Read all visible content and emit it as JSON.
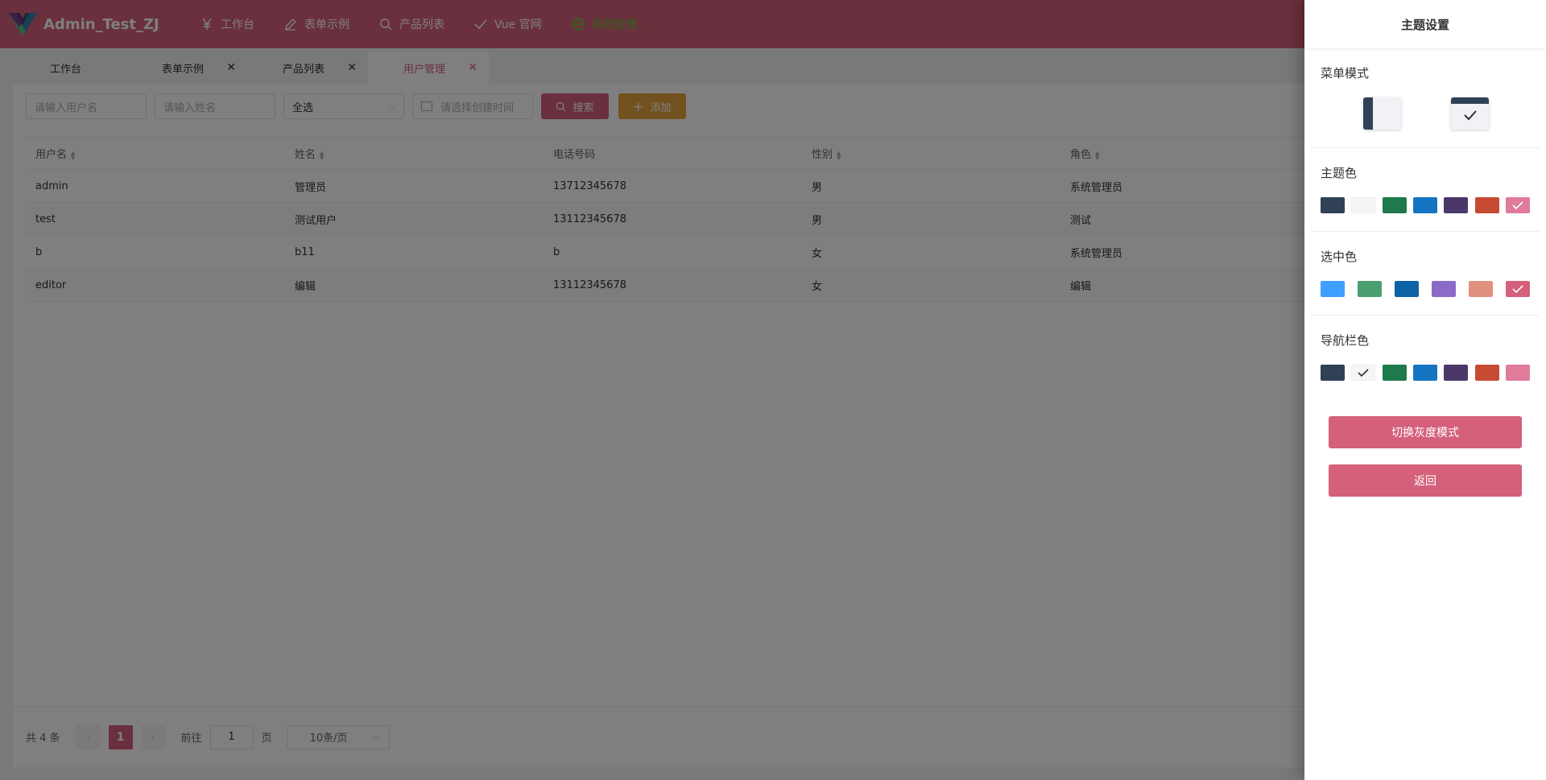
{
  "app": {
    "title": "Admin_Test_ZJ"
  },
  "topnav": [
    {
      "label": "工作台",
      "icon": "yen-icon"
    },
    {
      "label": "表单示例",
      "icon": "edit-icon"
    },
    {
      "label": "产品列表",
      "icon": "search-icon"
    },
    {
      "label": "Vue 官网",
      "icon": "check-icon"
    },
    {
      "label": "系统管理",
      "icon": "globe-icon",
      "active": true
    }
  ],
  "tabs": [
    {
      "label": "工作台",
      "closable": false
    },
    {
      "label": "表单示例",
      "closable": true
    },
    {
      "label": "产品列表",
      "closable": true
    },
    {
      "label": "用户管理",
      "closable": true,
      "active": true
    }
  ],
  "search": {
    "username_placeholder": "请输入用户名",
    "name_placeholder": "请输入姓名",
    "select_value": "全选",
    "date_placeholder": "请选择创建时间",
    "search_label": "搜索",
    "add_label": "添加"
  },
  "table": {
    "columns": [
      "用户名",
      "姓名",
      "电话号码",
      "性别",
      "角色"
    ],
    "rows": [
      [
        "admin",
        "管理员",
        "13712345678",
        "男",
        "系统管理员"
      ],
      [
        "test",
        "测试用户",
        "13112345678",
        "男",
        "测试"
      ],
      [
        "b",
        "b11",
        "b",
        "女",
        "系统管理员"
      ],
      [
        "editor",
        "编辑",
        "13112345678",
        "女",
        "编辑"
      ]
    ]
  },
  "pagination": {
    "total_text": "共 4 条",
    "current_page": "1",
    "goto_prefix": "前往",
    "goto_value": "1",
    "goto_suffix": "页",
    "page_size": "10条/页"
  },
  "drawer": {
    "title": "主题设置",
    "menu_mode_label": "菜单模式",
    "theme_color_label": "主题色",
    "selected_color_label": "选中色",
    "navbar_color_label": "导航栏色",
    "gray_mode_button": "切换灰度模式",
    "back_button": "返回",
    "theme_colors": [
      "#304156",
      "#f5f5f5",
      "#1e7a4a",
      "#1675c2",
      "#4a3869",
      "#c64b32",
      "#e07b9a"
    ],
    "theme_selected_index": 6,
    "selected_colors": [
      "#409eff",
      "#4c9f70",
      "#0d63a5",
      "#8c6bc7",
      "#e0917e",
      "#d4607a"
    ],
    "selected_selected_index": 5,
    "navbar_colors": [
      "#304156",
      "#f5f5f5",
      "#1e7a4a",
      "#1675c2",
      "#4a3869",
      "#c64b32",
      "#e07b9a"
    ],
    "navbar_selected_index": 1
  }
}
